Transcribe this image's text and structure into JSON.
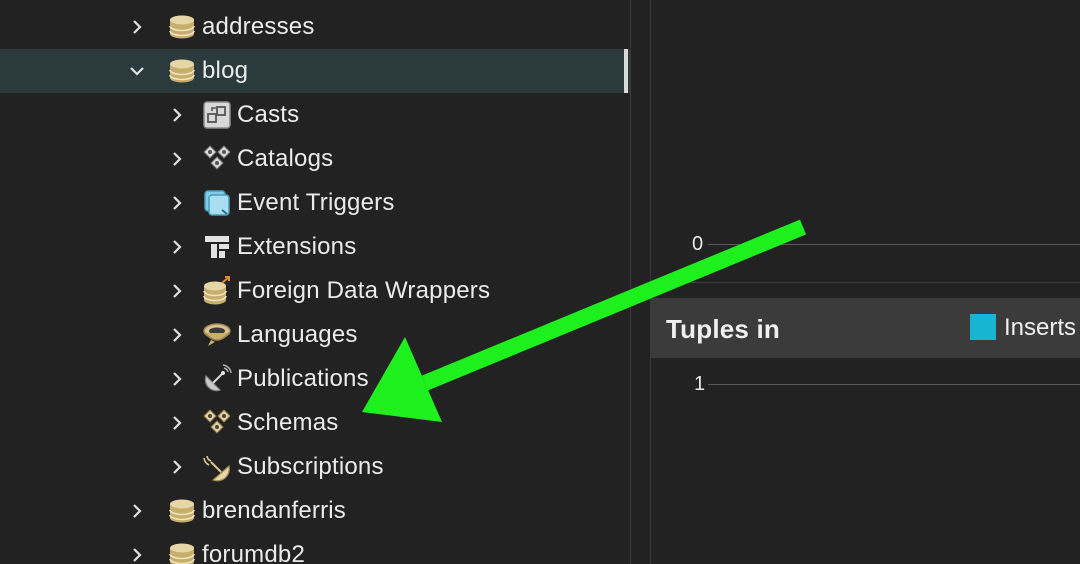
{
  "tree": {
    "rows": [
      {
        "label": "addresses",
        "icon": "database-icon",
        "expanded": false,
        "level": 1
      },
      {
        "label": "blog",
        "icon": "database-icon",
        "expanded": true,
        "level": 1,
        "selected": true
      },
      {
        "label": "Casts",
        "icon": "casts-icon",
        "expanded": false,
        "level": 2
      },
      {
        "label": "Catalogs",
        "icon": "catalogs-icon",
        "expanded": false,
        "level": 2
      },
      {
        "label": "Event Triggers",
        "icon": "event-triggers-icon",
        "expanded": false,
        "level": 2
      },
      {
        "label": "Extensions",
        "icon": "extensions-icon",
        "expanded": false,
        "level": 2
      },
      {
        "label": "Foreign Data Wrappers",
        "icon": "foreign-data-wrappers-icon",
        "expanded": false,
        "level": 2
      },
      {
        "label": "Languages",
        "icon": "languages-icon",
        "expanded": false,
        "level": 2
      },
      {
        "label": "Publications",
        "icon": "publications-icon",
        "expanded": false,
        "level": 2
      },
      {
        "label": "Schemas",
        "icon": "schemas-icon",
        "expanded": false,
        "level": 2
      },
      {
        "label": "Subscriptions",
        "icon": "subscriptions-icon",
        "expanded": false,
        "level": 2
      },
      {
        "label": "brendanferris",
        "icon": "database-icon",
        "expanded": false,
        "level": 1
      },
      {
        "label": "forumdb2",
        "icon": "database-icon",
        "expanded": false,
        "level": 1
      }
    ]
  },
  "dashboard": {
    "top_chart_tick": "0",
    "tuples_panel": {
      "title": "Tuples in",
      "legend_label": "Inserts",
      "legend_color": "#17b5d1",
      "tick": "1"
    }
  },
  "annotation": {
    "arrow_color": "#1ef01e",
    "points_to": "Schemas"
  },
  "colors": {
    "background": "#222222",
    "selected_row": "#2b3a3d",
    "panel_header": "#3b3b3b"
  }
}
